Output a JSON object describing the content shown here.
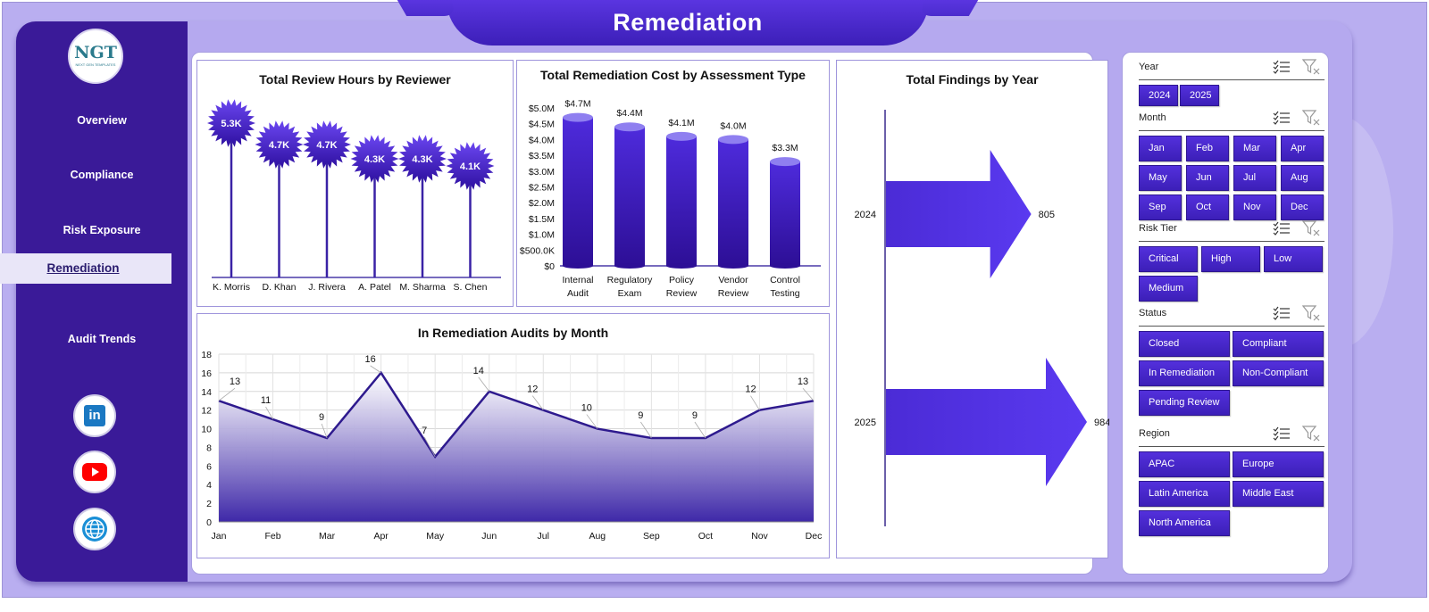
{
  "header": {
    "title": "Remediation"
  },
  "logo": {
    "text": "NGT",
    "subtitle": "NEXT GEN TEMPLATES"
  },
  "sidebar": {
    "items": [
      {
        "label": "Overview"
      },
      {
        "label": "Compliance"
      },
      {
        "label": "Risk Exposure"
      },
      {
        "label": "Remediation",
        "active": true
      },
      {
        "label": "Audit Trends"
      }
    ],
    "social": [
      {
        "icon": "linkedin-icon",
        "glyph": "in"
      },
      {
        "icon": "youtube-icon"
      },
      {
        "icon": "globe-icon"
      }
    ]
  },
  "colors": {
    "accent": "#4b2bd6",
    "sidebar": "#3a1a98",
    "background": "#b9aef0"
  },
  "chart_data": [
    {
      "type": "lollipop",
      "title": "Total Review Hours by Reviewer",
      "categories": [
        "K. Morris",
        "D. Khan",
        "J. Rivera",
        "A. Patel",
        "M. Sharma",
        "S. Chen"
      ],
      "values": [
        5300,
        4700,
        4700,
        4300,
        4300,
        4100
      ],
      "data_labels": [
        "5.3K",
        "4.7K",
        "4.7K",
        "4.3K",
        "4.3K",
        "4.1K"
      ],
      "grid": false
    },
    {
      "type": "bar",
      "title": "Total Remediation Cost by Assessment Type",
      "categories": [
        "Internal Audit",
        "Regulatory Exam",
        "Policy Review",
        "Vendor Review",
        "Control Testing"
      ],
      "values": [
        4.7,
        4.4,
        4.1,
        4.0,
        3.3
      ],
      "data_labels": [
        "$4.7M",
        "$4.4M",
        "$4.1M",
        "$4.0M",
        "$3.3M"
      ],
      "y_ticks": [
        "$0",
        "$500.0K",
        "$1.0M",
        "$1.5M",
        "$2.0M",
        "$2.5M",
        "$3.0M",
        "$3.5M",
        "$4.0M",
        "$4.5M",
        "$5.0M"
      ],
      "ylim": [
        0,
        5.0
      ],
      "grid": false
    },
    {
      "type": "bar",
      "orientation": "horizontal",
      "title": "Total Findings by Year",
      "categories": [
        "2024",
        "2025"
      ],
      "values": [
        805,
        984
      ],
      "grid": false
    },
    {
      "type": "area",
      "title": "In Remediation Audits by Month",
      "categories": [
        "Jan",
        "Feb",
        "Mar",
        "Apr",
        "May",
        "Jun",
        "Jul",
        "Aug",
        "Sep",
        "Oct",
        "Nov",
        "Dec"
      ],
      "values": [
        13,
        11,
        9,
        16,
        7,
        14,
        12,
        10,
        9,
        9,
        12,
        13
      ],
      "y_ticks": [
        "0",
        "2",
        "4",
        "6",
        "8",
        "10",
        "12",
        "14",
        "16",
        "18"
      ],
      "ylim": [
        0,
        18
      ],
      "grid": true
    }
  ],
  "slicers": [
    {
      "label": "Year",
      "options": [
        "2024",
        "2025"
      ]
    },
    {
      "label": "Month",
      "options": [
        "Jan",
        "Feb",
        "Mar",
        "Apr",
        "May",
        "Jun",
        "Jul",
        "Aug",
        "Sep",
        "Oct",
        "Nov",
        "Dec"
      ]
    },
    {
      "label": "Risk Tier",
      "options": [
        "Critical",
        "High",
        "Low",
        "Medium"
      ]
    },
    {
      "label": "Status",
      "options": [
        "Closed",
        "Compliant",
        "In Remediation",
        "Non-Compliant",
        "Pending Review"
      ]
    },
    {
      "label": "Region",
      "options": [
        "APAC",
        "Europe",
        "Latin America",
        "Middle East",
        "North America"
      ]
    }
  ]
}
